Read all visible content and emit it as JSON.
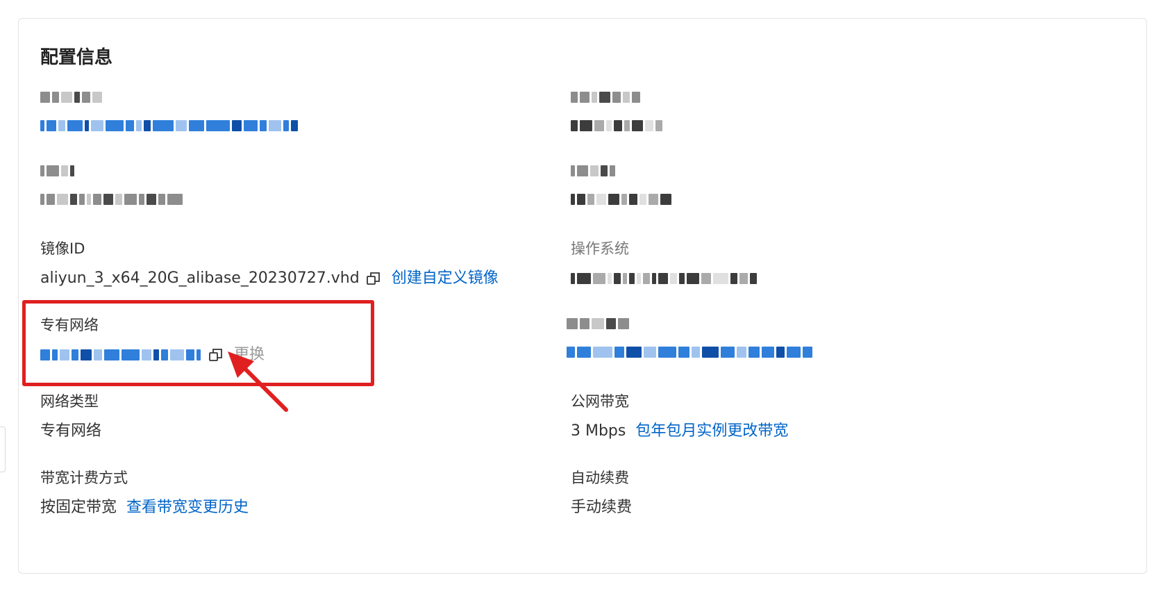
{
  "card": {
    "title": "配置信息"
  },
  "fields": {
    "image_id": {
      "label": "镜像ID",
      "value": "aliyun_3_x64_20G_alibase_20230727.vhd",
      "action": "创建自定义镜像"
    },
    "vpc": {
      "label": "专有网络",
      "action": "更换"
    },
    "network_type": {
      "label": "网络类型",
      "value": "专有网络"
    },
    "public_bandwidth": {
      "label": "公网带宽",
      "value": "3 Mbps",
      "action": "包年包月实例更改带宽"
    },
    "billing_method": {
      "label": "带宽计费方式",
      "value": "按固定带宽",
      "action": "查看带宽变更历史"
    },
    "auto_renew": {
      "label": "自动续费",
      "value": "手动续费"
    },
    "os": {
      "label": "操作系统"
    }
  },
  "icons": {
    "copy": "copy-icon"
  },
  "colors": {
    "link": "#0064c8",
    "muted": "#999999",
    "annotation": "#e02020"
  }
}
